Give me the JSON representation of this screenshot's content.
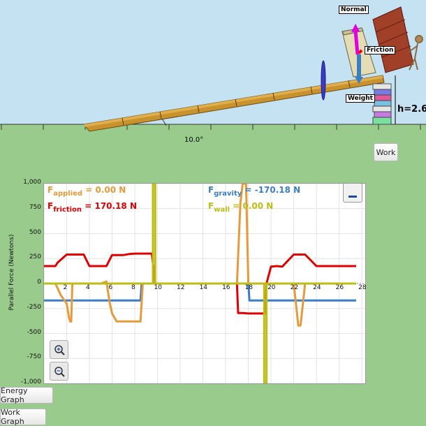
{
  "scene": {
    "angle_label": "10.0°",
    "height_label": "h=2.6",
    "force_labels": {
      "normal": "Normal",
      "friction": "Friction",
      "weight": "Weight"
    }
  },
  "buttons": {
    "work": "Work",
    "energy_graph": "Energy Graph",
    "work_graph": "Work Graph"
  },
  "graph": {
    "y_axis_label": "Parallel Force (Newtons)",
    "y_ticks": [
      "1,000",
      "750",
      "500",
      "250",
      "0",
      "-250",
      "-500",
      "-750",
      "-1,000"
    ],
    "x_ticks": [
      "2",
      "4",
      "6",
      "8",
      "10",
      "12",
      "14",
      "16",
      "18",
      "20",
      "22",
      "24",
      "26",
      "28"
    ],
    "legend": {
      "applied": {
        "F": "F",
        "sub": "applied",
        "value": "= 0.00 N",
        "color": "#E79A3A"
      },
      "friction": {
        "F": "F",
        "sub": "friction",
        "value": "= 170.18 N",
        "color": "#E00000"
      },
      "gravity": {
        "F": "F",
        "sub": "gravity",
        "value": "= -170.18 N",
        "color": "#3A7EC4"
      },
      "wall": {
        "F": "F",
        "sub": "wall",
        "value": "= 0.00 N",
        "color": "#BDBD16"
      }
    },
    "zoom_in_icon": "zoom-in-icon",
    "zoom_out_icon": "zoom-out-icon"
  },
  "chart_data": {
    "type": "line",
    "ylabel": "Parallel Force (Newtons)",
    "ylim": [
      -1000,
      1000
    ],
    "xlim": [
      0,
      28
    ],
    "series": [
      {
        "name": "Friction",
        "color": "#E00000",
        "x": [
          0,
          1,
          1.2,
          2,
          2.5,
          3.5,
          4,
          5,
          5.5,
          6,
          7,
          7.5,
          8,
          8.5,
          9.5,
          9.8,
          16,
          17,
          17.1,
          17.5,
          18,
          19,
          19.5,
          19.6,
          20,
          20.5,
          21,
          22,
          23,
          24,
          24.5,
          26,
          27.5
        ],
        "y": [
          175,
          175,
          210,
          290,
          290,
          290,
          175,
          175,
          175,
          285,
          285,
          295,
          300,
          300,
          300,
          0,
          0,
          0,
          -295,
          -295,
          -300,
          -300,
          -300,
          0,
          170,
          175,
          170,
          290,
          290,
          175,
          175,
          175,
          175
        ]
      },
      {
        "name": "Gravity",
        "color": "#3A7EC4",
        "x": [
          0,
          2,
          8.5,
          8.6,
          16,
          17,
          18,
          18.1,
          27.5
        ],
        "y": [
          -170,
          -170,
          -170,
          0,
          0,
          0,
          0,
          -170,
          -170
        ]
      },
      {
        "name": "Applied",
        "color": "#E79A3A",
        "x": [
          0,
          1,
          1.5,
          2,
          2.2,
          2.3,
          2.4,
          2.5,
          3,
          4,
          5,
          5.5,
          5.8,
          6,
          6.4,
          7,
          8,
          8.5,
          8.7,
          9,
          10,
          14,
          16,
          17,
          17.3,
          17.5,
          17.8,
          18,
          19,
          19.7,
          20,
          22,
          22.2,
          22.4,
          22.6,
          23,
          24,
          26,
          27.5
        ],
        "y": [
          0,
          0,
          -120,
          -200,
          -340,
          -380,
          -380,
          0,
          0,
          0,
          0,
          20,
          -200,
          -300,
          -380,
          -380,
          -380,
          -380,
          0,
          0,
          0,
          0,
          0,
          0,
          800,
          1000,
          1000,
          0,
          0,
          0,
          0,
          0,
          -200,
          -420,
          -420,
          0,
          0,
          0,
          0
        ]
      },
      {
        "name": "Wall",
        "color": "#BDBD16",
        "x": [
          0,
          9.6,
          9.6,
          9.8,
          9.8,
          19.4,
          19.4,
          19.6,
          19.6,
          27.5
        ],
        "y": [
          0,
          0,
          1000,
          1000,
          0,
          0,
          -1000,
          -1000,
          0,
          0
        ]
      }
    ]
  }
}
